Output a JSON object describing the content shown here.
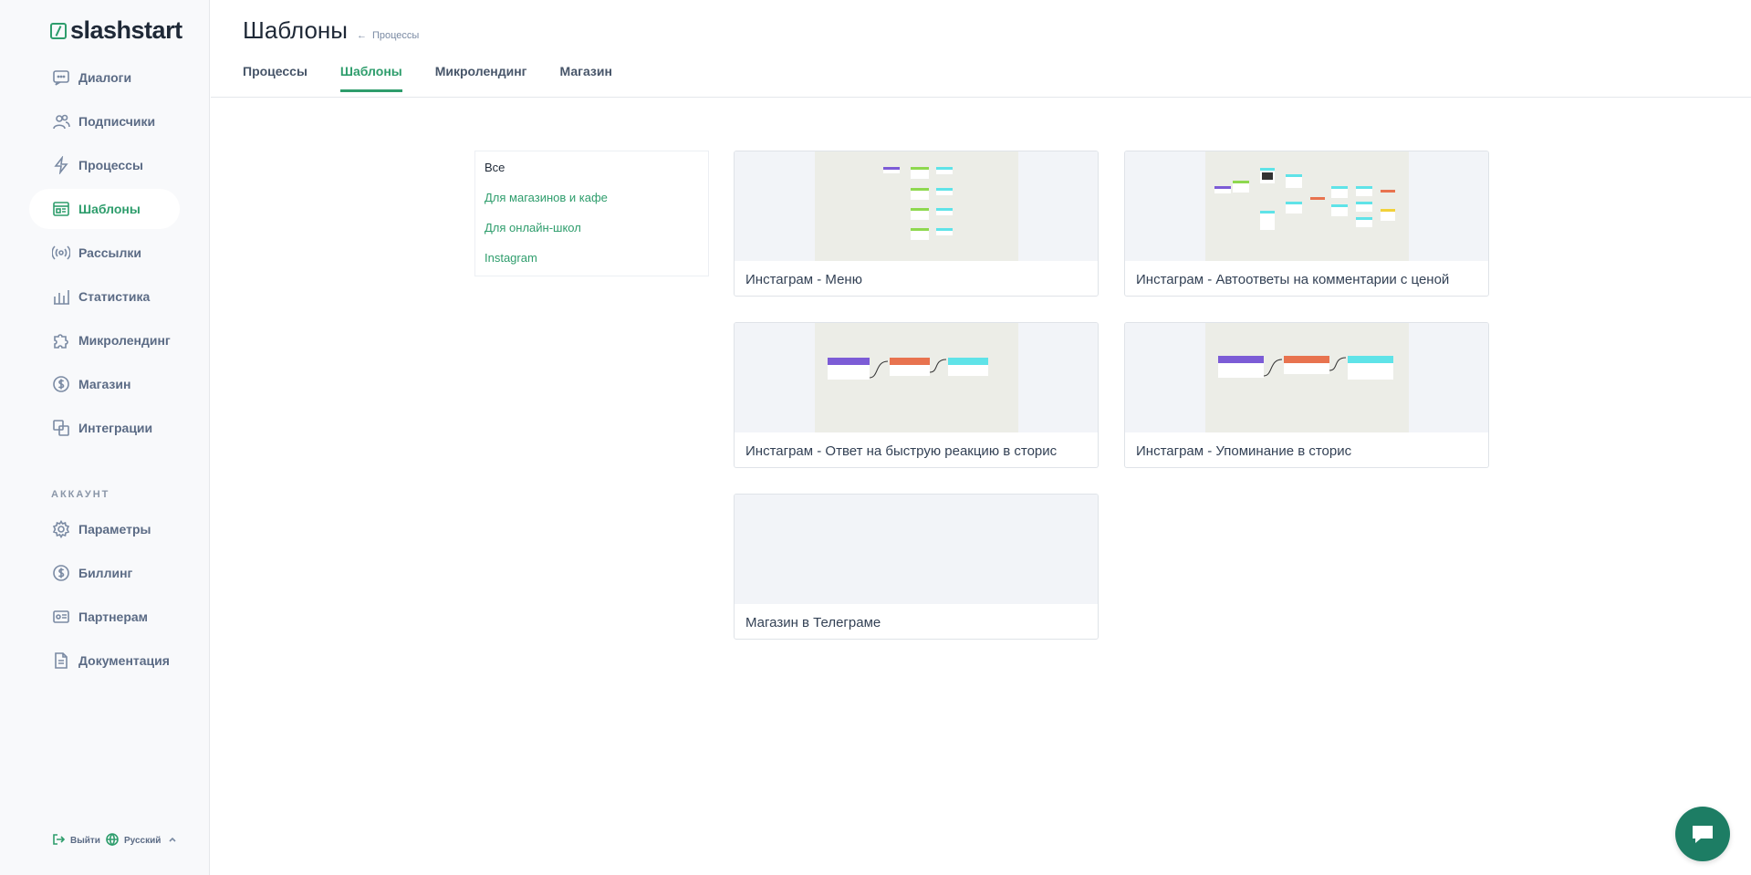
{
  "app": {
    "logo_text": "slashstart"
  },
  "sidebar": {
    "items": [
      {
        "label": "Диалоги",
        "icon": "chat-icon"
      },
      {
        "label": "Подписчики",
        "icon": "users-icon"
      },
      {
        "label": "Процессы",
        "icon": "lightning-icon"
      },
      {
        "label": "Шаблоны",
        "icon": "template-icon",
        "active": true
      },
      {
        "label": "Рассылки",
        "icon": "broadcast-icon"
      },
      {
        "label": "Статистика",
        "icon": "chart-icon"
      },
      {
        "label": "Микролендинг",
        "icon": "puzzle-icon"
      },
      {
        "label": "Магазин",
        "icon": "dollar-icon"
      },
      {
        "label": "Интеграции",
        "icon": "integrations-icon"
      }
    ],
    "account_title": "АККАУНТ",
    "account_items": [
      {
        "label": "Параметры",
        "icon": "gear-icon"
      },
      {
        "label": "Биллинг",
        "icon": "dollar-icon"
      },
      {
        "label": "Партнерам",
        "icon": "partners-icon"
      },
      {
        "label": "Документация",
        "icon": "document-icon"
      }
    ],
    "footer": {
      "logout": "Выйти",
      "language": "Русский"
    }
  },
  "header": {
    "title": "Шаблоны",
    "breadcrumb_arrow": "←",
    "breadcrumb": "Процессы"
  },
  "tabs": [
    {
      "label": "Процессы"
    },
    {
      "label": "Шаблоны",
      "active": true
    },
    {
      "label": "Микролендинг"
    },
    {
      "label": "Магазин"
    }
  ],
  "filters": [
    {
      "label": "Все",
      "active": true
    },
    {
      "label": "Для магазинов и кафе"
    },
    {
      "label": "Для онлайн-школ"
    },
    {
      "label": "Instagram"
    }
  ],
  "templates": [
    {
      "title": "Инстаграм - Меню"
    },
    {
      "title": "Инстаграм - Автоответы на комментарии с ценой"
    },
    {
      "title": "Инстаграм - Ответ на быструю реакцию в сторис"
    },
    {
      "title": "Инстаграм - Упоминание в сторис"
    },
    {
      "title": "Магазин в Телеграме"
    }
  ],
  "colors": {
    "accent": "#2e9d6c",
    "chat_button": "#1d7d64"
  }
}
